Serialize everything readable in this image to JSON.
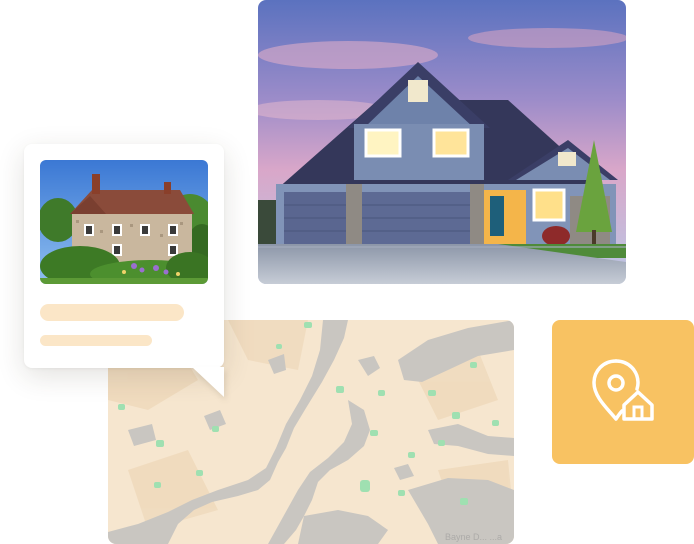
{
  "hero": {
    "image": "modern-house-photo"
  },
  "card": {
    "image": "brick-cottage-photo",
    "title_placeholder_color": "#fbe6c7",
    "subtitle_placeholder_color": "#fbe6c7"
  },
  "map": {
    "watermark": "Bayne D... ...a",
    "land_color": "#f6e6cf",
    "water_color": "#c9c6c1",
    "park_color": "#9fe0b1"
  },
  "location_tile": {
    "icon": "home-location-pin-icon",
    "background": "#f8c262",
    "icon_color": "#ffffff"
  }
}
